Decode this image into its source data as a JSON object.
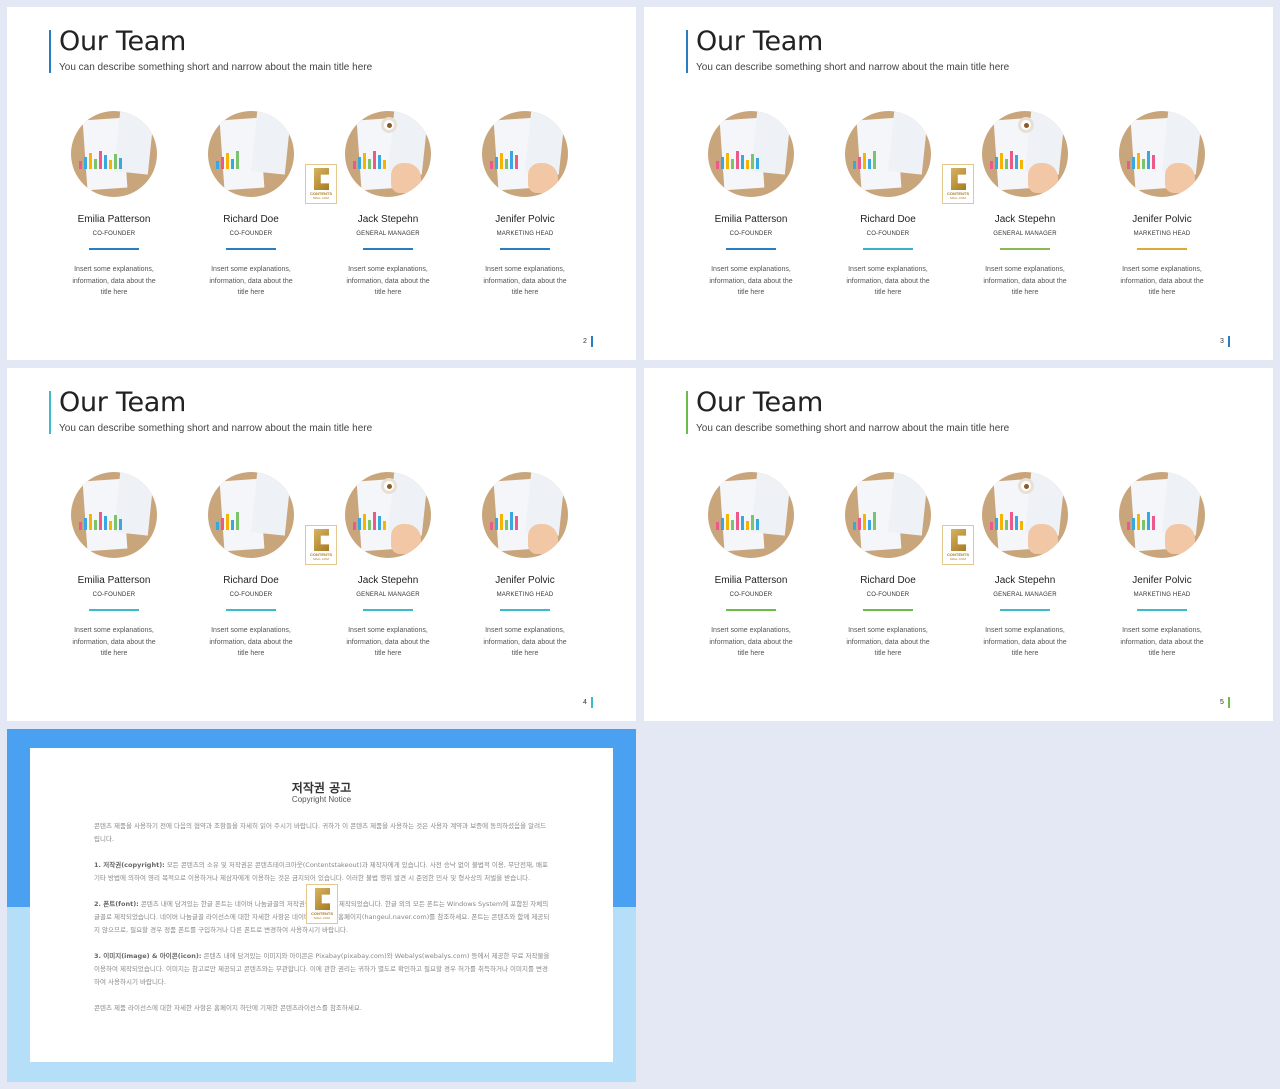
{
  "slides": [
    {
      "title": "Our Team",
      "subtitle": "You can describe something short and narrow about the main title here",
      "page": "2",
      "accent": "#2a7ec0",
      "underline_colors": [
        "#2a7ec0",
        "#2a7ec0",
        "#2a7ec0",
        "#2a7ec0"
      ]
    },
    {
      "title": "Our Team",
      "subtitle": "You can describe something short and narrow about the main title here",
      "page": "3",
      "accent": "#2a7ec0",
      "underline_colors": [
        "#2a7ec0",
        "#3ab0c8",
        "#8ab858",
        "#e0a838"
      ]
    },
    {
      "title": "Our Team",
      "subtitle": "You can describe something short and narrow about the main title here",
      "page": "4",
      "accent": "#3cbcc8",
      "underline_colors": [
        "#3cbcc8",
        "#3cbcc8",
        "#3cbcc8",
        "#3cbcc8"
      ]
    },
    {
      "title": "Our Team",
      "subtitle": "You can describe something short and narrow about the main title here",
      "page": "5",
      "accent": "#6cbc4c",
      "underline_colors": [
        "#6cbc4c",
        "#6cbc4c",
        "#3cbcc8",
        "#3cbcc8"
      ]
    }
  ],
  "members": [
    {
      "name": "Emilia Patterson",
      "role": "CO-FOUNDER",
      "desc": "Insert some explanations, information, data about the title here"
    },
    {
      "name": "Richard Doe",
      "role": "CO-FOUNDER",
      "desc": "Insert some explanations, information, data about the title here"
    },
    {
      "name": "Jack Stepehn",
      "role": "GENERAL MANAGER",
      "desc": "Insert some explanations, information, data about the title here"
    },
    {
      "name": "Jenifer Polvic",
      "role": "MARKETING HEAD",
      "desc": "Insert some explanations, information, data about the title here"
    }
  ],
  "logo": {
    "line1": "CONTENTS",
    "line2": "MALL.COM"
  },
  "copyright": {
    "title": "저작권 공고",
    "subtitle": "Copyright Notice",
    "intro": "콘텐츠 제품을 사용하기 전에 다음의 협약과 조항들을 자세히 읽어 주시기 바랍니다. 귀하가 이 콘텐츠 제품을 사용하는 것은 사용자 계약과 보증에 동의하셨음을 알려드립니다.",
    "p1_head": "1. 저작권(copyright):",
    "p1": " 모든 콘텐츠의 소유 및 저작권은 콘텐츠테이크아웃(Contentstakeout)과 제작자에게 있습니다. 사전 승낙 없이 불법적 이용, 무단전재, 배포 기타 방법에 의하여 영리 목적으로 이용하거나 제삼자에게 이용하는 것은 금지되어 있습니다. 이러한 불법 행위 발견 시 준엄한 민사 및 형사상의 처벌을 받습니다.",
    "p2_head": "2. 폰트(font):",
    "p2": " 콘텐츠 내에 담겨있는 한글 폰트는 네이버 나눔글꼴의 저작권을 사용하여 제작되었습니다. 한글 외의 모든 폰트는 Windows System에 포함된 자체의 글꼴로 제작되었습니다. 네이버 나눔글꼴 라이선스에 대한 자세한 사항은 네이버 나눔글꼴 홈페이지(hangeul.naver.com)를 참조하세요. 폰트는 콘텐츠와 함께 제공되지 않으므로, 필요할 경우 정품 폰트를 구입하거나 다른 폰트로 변경하여 사용하시기 바랍니다.",
    "p3_head": "3. 이미지(image) & 아이콘(icon):",
    "p3": " 콘텐츠 내에 담겨있는 이미지와 아이콘은 Pixabay(pixabay.com)와 Webalys(webalys.com) 등에서 제공한 무료 저작물을 이용하여 제작되었습니다. 이미지는 참고로만 제공되고 콘텐츠와는 무관합니다. 이에 관한 권리는 귀하가 별도로 확인하고 필요할 경우 허가를 취득하거나 이미지를 변경하여 사용하시기 바랍니다.",
    "outro": "콘텐츠 제품 라이선스에 대한 자세한 사항은 홈페이지 하단에 기재한 콘텐츠라이선스를 참조하세요."
  }
}
